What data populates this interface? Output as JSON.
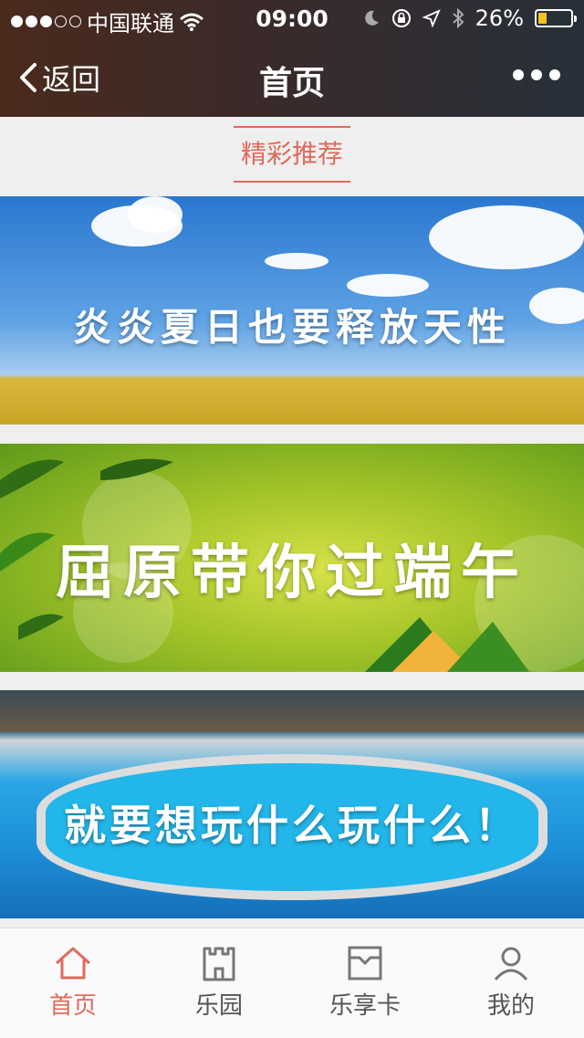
{
  "status_bar": {
    "carrier": "中国联通",
    "time": "09:00",
    "battery_percent": "26%",
    "battery_level": 0.26,
    "signal_dots_filled": 3,
    "signal_dots_total": 5,
    "icons": [
      "wifi-icon",
      "moon-icon",
      "rotation-lock-icon",
      "location-arrow-icon",
      "bluetooth-icon",
      "battery-icon"
    ]
  },
  "nav": {
    "back_label": "返回",
    "title": "首页",
    "more_icon": "more-dots-icon"
  },
  "section": {
    "title": "精彩推荐"
  },
  "banners": [
    {
      "caption": "炎炎夏日也要释放天性"
    },
    {
      "caption": "屈原带你过端午"
    },
    {
      "caption": "就要想玩什么玩什么！"
    }
  ],
  "tabbar": {
    "tabs": [
      {
        "label": "首页",
        "icon": "home-icon",
        "active": true
      },
      {
        "label": "乐园",
        "icon": "castle-icon",
        "active": false
      },
      {
        "label": "乐享卡",
        "icon": "card-box-icon",
        "active": false
      },
      {
        "label": "我的",
        "icon": "user-icon",
        "active": false
      }
    ]
  },
  "colors": {
    "accent": "#e06a5c",
    "battery": "#f5c21b",
    "background": "#efefef"
  }
}
